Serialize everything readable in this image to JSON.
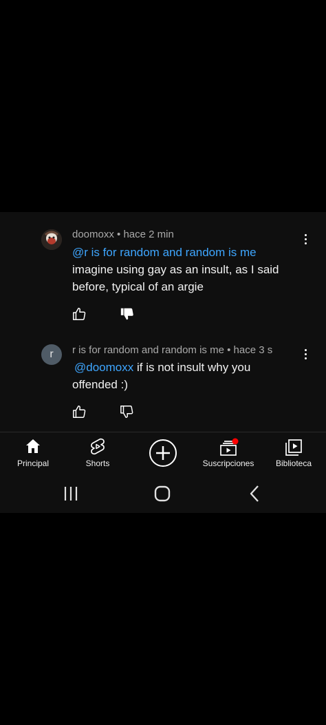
{
  "comments": [
    {
      "author": "doomoxx",
      "time": "hace 2 min",
      "meta": "doomoxx • hace 2 min",
      "mention": "@r is for random and random is me",
      "text_line1": "imagine using gay as an insult, as I said",
      "text_line2": "before, typical of an argie",
      "liked": false,
      "disliked": true
    },
    {
      "author": "r is for random and random is me",
      "avatar_letter": "r",
      "meta": "r is for random and random is me • hace 3 s",
      "mention": "@doomoxx",
      "text_line1_rest": " if is not insult why you",
      "text_line2": "offended :)",
      "liked": false,
      "disliked": false
    }
  ],
  "nav": {
    "items": [
      {
        "label": "Principal",
        "icon": "home-icon",
        "active": true
      },
      {
        "label": "Shorts",
        "icon": "shorts-icon"
      },
      {
        "label": "",
        "icon": "create-icon"
      },
      {
        "label": "Suscripciones",
        "icon": "subscriptions-icon",
        "notification_dot": true
      },
      {
        "label": "Biblioteca",
        "icon": "library-icon"
      }
    ]
  },
  "colors": {
    "background": "#000000",
    "panel": "#0f0f0f",
    "mention": "#3ea6ff",
    "meta_text": "#aaaaaa",
    "notification_dot": "#ff0000"
  }
}
